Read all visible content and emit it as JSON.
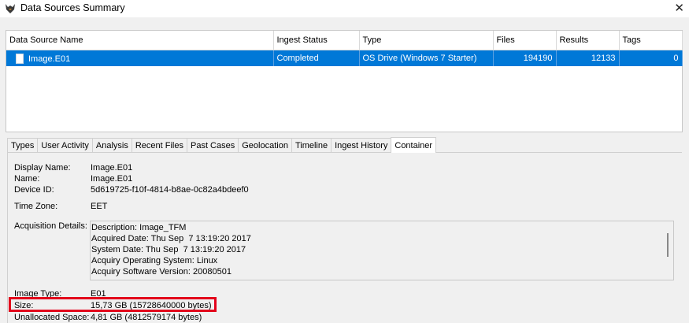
{
  "window": {
    "title": "Data Sources Summary",
    "close_glyph": "✕"
  },
  "table": {
    "columns": [
      "Data Source Name",
      "Ingest Status",
      "Type",
      "Files",
      "Results",
      "Tags"
    ],
    "rows": [
      {
        "name": "Image.E01",
        "status": "Completed",
        "type": "OS Drive (Windows 7 Starter)",
        "files": "194190",
        "results": "12133",
        "tags": "0"
      }
    ]
  },
  "tabs": [
    "Types",
    "User Activity",
    "Analysis",
    "Recent Files",
    "Past Cases",
    "Geolocation",
    "Timeline",
    "Ingest History",
    "Container"
  ],
  "active_tab": "Container",
  "container": {
    "display_name_label": "Display Name:",
    "display_name": "Image.E01",
    "name_label": "Name:",
    "name": "Image.E01",
    "device_id_label": "Device ID:",
    "device_id": "5d619725-f10f-4814-b8ae-0c82a4bdeef0",
    "time_zone_label": "Time Zone:",
    "time_zone": "EET",
    "acquisition_label": "Acquisition Details:",
    "acquisition_lines": [
      "Description: Image_TFM",
      "Acquired Date: Thu Sep  7 13:19:20 2017",
      "System Date: Thu Sep  7 13:19:20 2017",
      "Acquiry Operating System: Linux",
      "Acquiry Software Version: 20080501"
    ],
    "image_type_label": "Image Type:",
    "image_type": "E01",
    "size_label": "Size:",
    "size": "15,73 GB (15728640000 bytes)",
    "unallocated_label": "Unallocated Space:",
    "unallocated": "4,81 GB (4812579174 bytes)"
  },
  "colors": {
    "selection": "#0078d7",
    "highlight_box": "#e3001b"
  }
}
